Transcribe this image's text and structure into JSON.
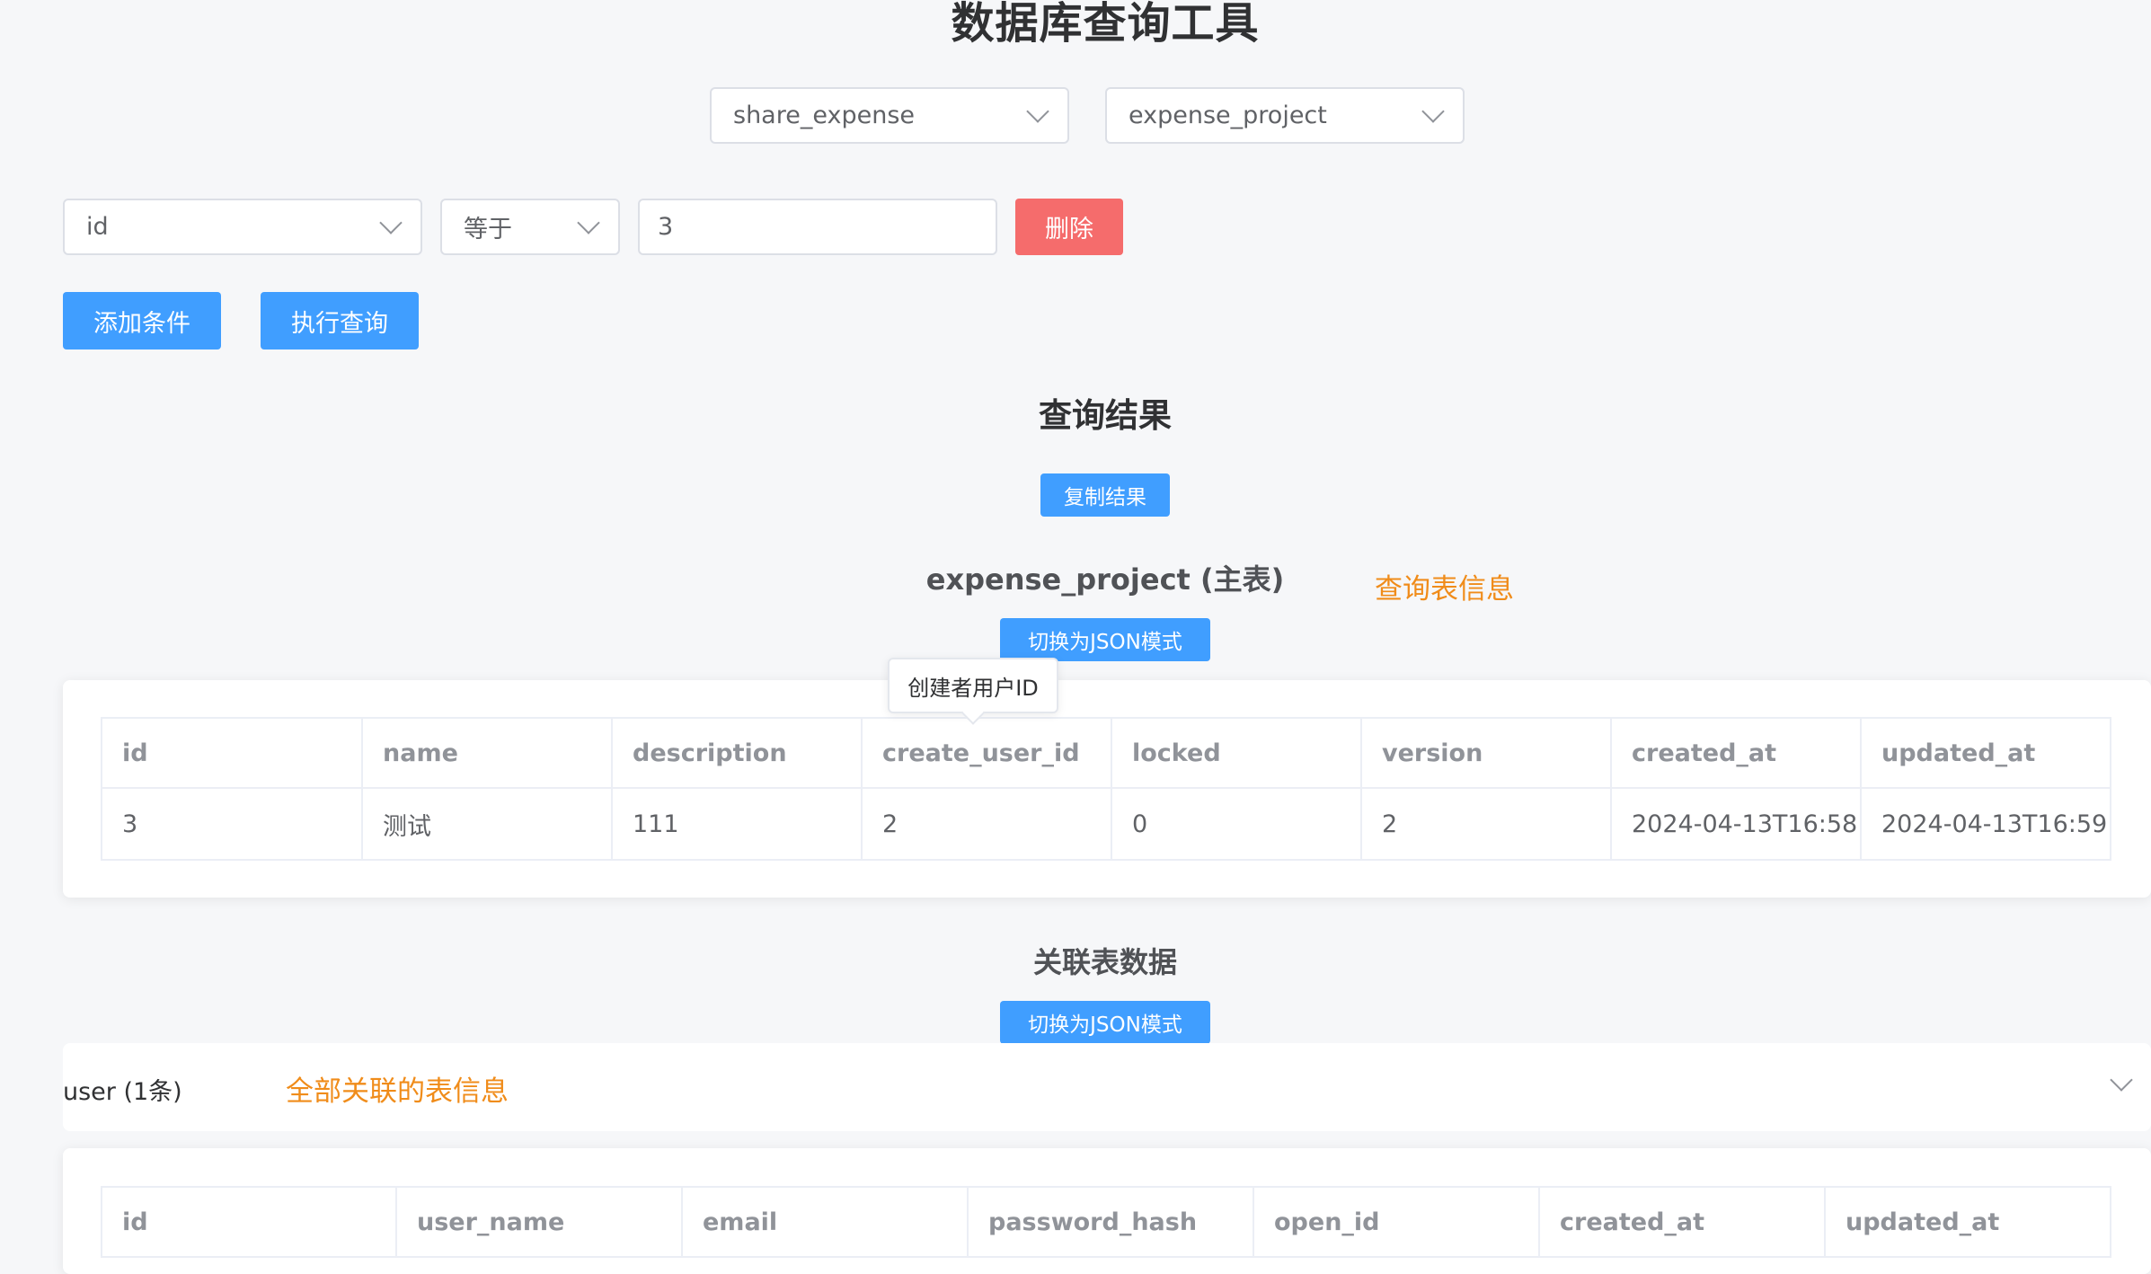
{
  "page_title": "数据库查询工具",
  "selectors": {
    "database": "share_expense",
    "table": "expense_project"
  },
  "condition": {
    "field": "id",
    "operator": "等于",
    "value": "3",
    "delete_label": "删除"
  },
  "actions": {
    "add_condition": "添加条件",
    "execute_query": "执行查询"
  },
  "results": {
    "title": "查询结果",
    "copy_label": "复制结果",
    "main_table_title": "expense_project (主表)",
    "main_table_note": "查询表信息",
    "toggle_json_label": "切换为JSON模式",
    "tooltip": "创建者用户ID",
    "main_table": {
      "columns": [
        "id",
        "name",
        "description",
        "create_user_id",
        "locked",
        "version",
        "created_at",
        "updated_at"
      ],
      "rows": [
        [
          "3",
          "测试",
          "111",
          "2",
          "0",
          "2",
          "2024-04-13T16:58",
          "2024-04-13T16:59"
        ]
      ]
    }
  },
  "related": {
    "title": "关联表数据",
    "toggle_json_label": "切换为JSON模式",
    "user_panel": {
      "header": "user (1条)",
      "note": "全部关联的表信息"
    },
    "user_table": {
      "columns": [
        "id",
        "user_name",
        "email",
        "password_hash",
        "open_id",
        "created_at",
        "updated_at"
      ]
    }
  },
  "colors": {
    "primary": "#409eff",
    "danger": "#f56c6c",
    "note": "#f08c1a",
    "background": "#f6f7f9"
  }
}
